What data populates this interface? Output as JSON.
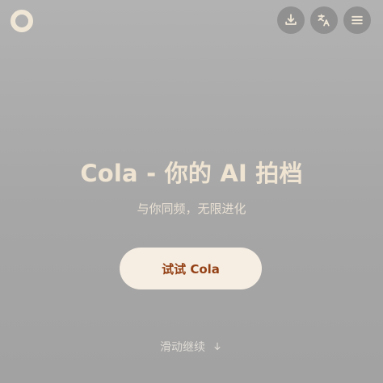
{
  "brand": {
    "logo": "ring-logo"
  },
  "header": {
    "buttons": [
      {
        "icon": "download-icon"
      },
      {
        "icon": "translate-icon"
      },
      {
        "icon": "menu-icon"
      }
    ]
  },
  "hero": {
    "title": "Cola - 你的 AI 拍档",
    "subtitle": "与你同频，无限进化",
    "cta_label": "试试 Cola"
  },
  "scroll": {
    "label": "滑动继续",
    "icon": "arrow-down-icon"
  },
  "colors": {
    "background": "#a8a8a8",
    "accent_text": "#efe4d2",
    "button_bg": "#f6eee3",
    "button_text": "#944116"
  }
}
